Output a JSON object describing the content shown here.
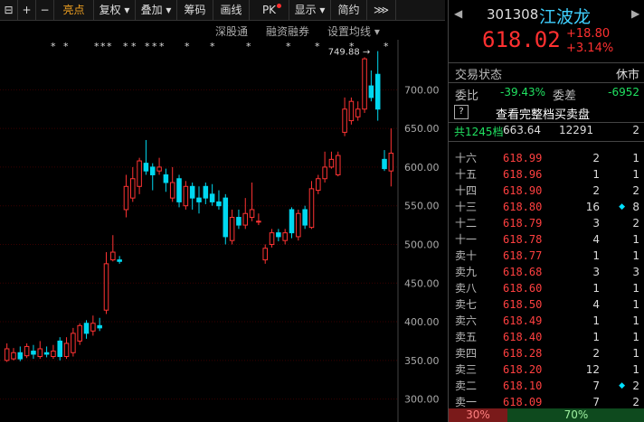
{
  "toolbar": {
    "items": [
      {
        "label": "⊟",
        "name": "layout-icon"
      },
      {
        "label": "+",
        "name": "zoom-in-button"
      },
      {
        "label": "−",
        "name": "zoom-out-button"
      },
      {
        "label": "亮点",
        "name": "highlight-tab"
      },
      {
        "label": "复权 ▾",
        "name": "adjust-dropdown"
      },
      {
        "label": "叠加 ▾",
        "name": "overlay-dropdown"
      },
      {
        "label": "筹码",
        "name": "chips-button"
      },
      {
        "label": "画线",
        "name": "draw-line-button"
      },
      {
        "label": "PK",
        "name": "pk-button"
      },
      {
        "label": "显示 ▾",
        "name": "display-dropdown"
      },
      {
        "label": "简约",
        "name": "simple-button"
      },
      {
        "label": "⋙",
        "name": "expand-icon"
      }
    ]
  },
  "subbar": {
    "shenzhen_connect": "深股通",
    "margin": "融资融券",
    "ma_settings": "设置均线 ▾"
  },
  "chart_data": {
    "type": "candlestick",
    "yticks": [
      300,
      350,
      400,
      450,
      500,
      550,
      600,
      650,
      700
    ],
    "ytick_labels": [
      "300.00",
      "350.00",
      "400.00",
      "450.00",
      "500.00",
      "550.00",
      "600.00",
      "650.00",
      "700.00"
    ],
    "ylim": [
      275,
      760
    ],
    "grid": true,
    "max_annotation": "749.88",
    "marker_symbol": "*",
    "up_color": "#ff3333",
    "down_color": "#00d8f0",
    "candles": [
      {
        "o": 350,
        "c": 365,
        "h": 372,
        "l": 348
      },
      {
        "o": 352,
        "c": 360,
        "h": 366,
        "l": 350
      },
      {
        "o": 360,
        "c": 352,
        "h": 368,
        "l": 349
      },
      {
        "o": 356,
        "c": 368,
        "h": 372,
        "l": 353
      },
      {
        "o": 362,
        "c": 358,
        "h": 370,
        "l": 352
      },
      {
        "o": 355,
        "c": 365,
        "h": 375,
        "l": 352
      },
      {
        "o": 360,
        "c": 358,
        "h": 368,
        "l": 354
      },
      {
        "o": 355,
        "c": 362,
        "h": 370,
        "l": 352
      },
      {
        "o": 375,
        "c": 355,
        "h": 380,
        "l": 350
      },
      {
        "o": 355,
        "c": 372,
        "h": 380,
        "l": 352
      },
      {
        "o": 360,
        "c": 385,
        "h": 392,
        "l": 355
      },
      {
        "o": 375,
        "c": 395,
        "h": 398,
        "l": 370
      },
      {
        "o": 398,
        "c": 385,
        "h": 402,
        "l": 378
      },
      {
        "o": 388,
        "c": 398,
        "h": 408,
        "l": 382
      },
      {
        "o": 395,
        "c": 392,
        "h": 405,
        "l": 388
      },
      {
        "o": 415,
        "c": 475,
        "h": 490,
        "l": 410
      },
      {
        "o": 480,
        "c": 490,
        "h": 512,
        "l": 478
      },
      {
        "o": 480,
        "c": 478,
        "h": 485,
        "l": 475
      },
      {
        "o": 545,
        "c": 575,
        "h": 590,
        "l": 535
      },
      {
        "o": 560,
        "c": 585,
        "h": 600,
        "l": 555
      },
      {
        "o": 575,
        "c": 608,
        "h": 612,
        "l": 565
      },
      {
        "o": 605,
        "c": 595,
        "h": 635,
        "l": 590
      },
      {
        "o": 600,
        "c": 590,
        "h": 605,
        "l": 570
      },
      {
        "o": 595,
        "c": 600,
        "h": 612,
        "l": 590
      },
      {
        "o": 590,
        "c": 580,
        "h": 598,
        "l": 568
      },
      {
        "o": 560,
        "c": 580,
        "h": 600,
        "l": 555
      },
      {
        "o": 585,
        "c": 555,
        "h": 590,
        "l": 548
      },
      {
        "o": 550,
        "c": 575,
        "h": 582,
        "l": 545
      },
      {
        "o": 575,
        "c": 560,
        "h": 580,
        "l": 545
      },
      {
        "o": 560,
        "c": 555,
        "h": 575,
        "l": 540
      },
      {
        "o": 575,
        "c": 560,
        "h": 580,
        "l": 552
      },
      {
        "o": 565,
        "c": 555,
        "h": 578,
        "l": 550
      },
      {
        "o": 555,
        "c": 550,
        "h": 570,
        "l": 545
      },
      {
        "o": 560,
        "c": 510,
        "h": 565,
        "l": 500
      },
      {
        "o": 505,
        "c": 535,
        "h": 545,
        "l": 500
      },
      {
        "o": 535,
        "c": 525,
        "h": 545,
        "l": 520
      },
      {
        "o": 525,
        "c": 540,
        "h": 560,
        "l": 520
      },
      {
        "o": 535,
        "c": 545,
        "h": 580,
        "l": 530
      },
      {
        "o": 530,
        "c": 530,
        "h": 540,
        "l": 525
      },
      {
        "o": 480,
        "c": 495,
        "h": 500,
        "l": 475
      },
      {
        "o": 500,
        "c": 515,
        "h": 520,
        "l": 496
      },
      {
        "o": 515,
        "c": 510,
        "h": 520,
        "l": 504
      },
      {
        "o": 505,
        "c": 515,
        "h": 520,
        "l": 500
      },
      {
        "o": 545,
        "c": 515,
        "h": 548,
        "l": 508
      },
      {
        "o": 510,
        "c": 540,
        "h": 545,
        "l": 505
      },
      {
        "o": 545,
        "c": 525,
        "h": 550,
        "l": 520
      },
      {
        "o": 522,
        "c": 572,
        "h": 582,
        "l": 520
      },
      {
        "o": 570,
        "c": 585,
        "h": 590,
        "l": 565
      },
      {
        "o": 585,
        "c": 600,
        "h": 620,
        "l": 580
      },
      {
        "o": 600,
        "c": 610,
        "h": 620,
        "l": 598
      },
      {
        "o": 590,
        "c": 615,
        "h": 620,
        "l": 588
      },
      {
        "o": 645,
        "c": 675,
        "h": 690,
        "l": 640
      },
      {
        "o": 660,
        "c": 685,
        "h": 690,
        "l": 655
      },
      {
        "o": 665,
        "c": 675,
        "h": 685,
        "l": 660
      },
      {
        "o": 675,
        "c": 740,
        "h": 742,
        "l": 670
      },
      {
        "o": 705,
        "c": 690,
        "h": 725,
        "l": 685
      },
      {
        "o": 720,
        "c": 675,
        "h": 750,
        "l": 660
      },
      {
        "o": 610,
        "c": 598,
        "h": 622,
        "l": 595
      },
      {
        "o": 595,
        "c": 618,
        "h": 650,
        "l": 575
      }
    ],
    "marker_rows": [
      1,
      1,
      1,
      1,
      1,
      1,
      1,
      1,
      1,
      1,
      1,
      1,
      1,
      1,
      1,
      1
    ]
  },
  "quote": {
    "code": "301308",
    "name": "江波龙",
    "price": "618.02",
    "change": "+18.80",
    "pct": "+3.14%",
    "status_label": "交易状态",
    "status_value": "休市",
    "ratio_label": "委比",
    "ratio_value": "-39.43%",
    "diff_label": "委差",
    "diff_value": "-6952",
    "view_full": "查看完整档买卖盘",
    "help_icon": "?",
    "total_label": "共1245档",
    "total_price": "663.64",
    "total_vol": "12291",
    "total_cnt": "2"
  },
  "book": [
    {
      "label": "十六",
      "price": "618.99",
      "vol": "2",
      "cnt": "1",
      "mark": ""
    },
    {
      "label": "十五",
      "price": "618.96",
      "vol": "1",
      "cnt": "1",
      "mark": ""
    },
    {
      "label": "十四",
      "price": "618.90",
      "vol": "2",
      "cnt": "2",
      "mark": ""
    },
    {
      "label": "十三",
      "price": "618.80",
      "vol": "16",
      "cnt": "8",
      "mark": "◆"
    },
    {
      "label": "十二",
      "price": "618.79",
      "vol": "3",
      "cnt": "2",
      "mark": ""
    },
    {
      "label": "十一",
      "price": "618.78",
      "vol": "4",
      "cnt": "1",
      "mark": ""
    },
    {
      "label": "卖十",
      "price": "618.77",
      "vol": "1",
      "cnt": "1",
      "mark": ""
    },
    {
      "label": "卖九",
      "price": "618.68",
      "vol": "3",
      "cnt": "3",
      "mark": ""
    },
    {
      "label": "卖八",
      "price": "618.60",
      "vol": "1",
      "cnt": "1",
      "mark": ""
    },
    {
      "label": "卖七",
      "price": "618.50",
      "vol": "4",
      "cnt": "1",
      "mark": ""
    },
    {
      "label": "卖六",
      "price": "618.49",
      "vol": "1",
      "cnt": "1",
      "mark": ""
    },
    {
      "label": "卖五",
      "price": "618.40",
      "vol": "1",
      "cnt": "1",
      "mark": ""
    },
    {
      "label": "卖四",
      "price": "618.28",
      "vol": "2",
      "cnt": "1",
      "mark": ""
    },
    {
      "label": "卖三",
      "price": "618.20",
      "vol": "12",
      "cnt": "1",
      "mark": ""
    },
    {
      "label": "卖二",
      "price": "618.10",
      "vol": "7",
      "cnt": "2",
      "mark": "◆"
    },
    {
      "label": "卖一",
      "price": "618.09",
      "vol": "7",
      "cnt": "2",
      "mark": ""
    }
  ],
  "footer": {
    "sell_pct": "30%",
    "buy_pct": "70%",
    "sell_ratio": 0.3,
    "sell_color": "#7a1a1a",
    "buy_color": "#0e4a1e"
  }
}
